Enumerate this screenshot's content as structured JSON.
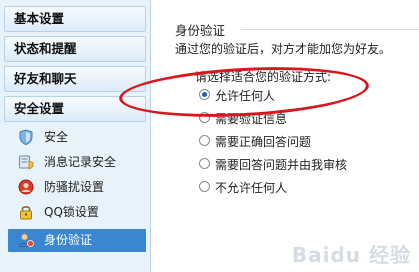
{
  "sidebar": {
    "categories": [
      "基本设置",
      "状态和提醒",
      "好友和聊天",
      "安全设置"
    ],
    "security_items": [
      {
        "label": "安全",
        "icon": "shield-icon"
      },
      {
        "label": "消息记录安全",
        "icon": "message-record-icon"
      },
      {
        "label": "防骚扰设置",
        "icon": "anti-harass-icon"
      },
      {
        "label": "QQ锁设置",
        "icon": "lock-icon"
      },
      {
        "label": "身份验证",
        "icon": "user-verify-icon",
        "selected": true
      }
    ]
  },
  "main": {
    "section_title": "身份验证",
    "description": "通过您的验证后，对方才能加您为好友。",
    "prompt": "请选择适合您的验证方式:",
    "options": [
      {
        "label": "允许任何人",
        "checked": true
      },
      {
        "label": "需要验证信息",
        "checked": false
      },
      {
        "label": "需要正确回答问题",
        "checked": false
      },
      {
        "label": "需要回答问题并由我审核",
        "checked": false
      },
      {
        "label": "不允许任何人",
        "checked": false
      }
    ]
  },
  "annotation": {
    "color": "#d9151d"
  },
  "watermark": "Baidu 经验"
}
